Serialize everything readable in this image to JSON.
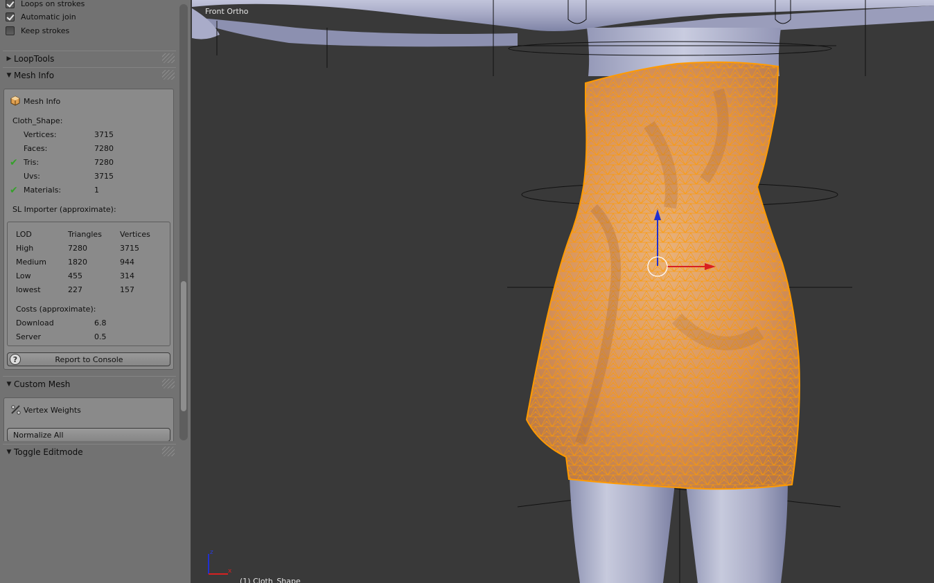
{
  "toolshelf": {
    "options": [
      {
        "label": "Loops on strokes",
        "checked": true
      },
      {
        "label": "Automatic join",
        "checked": true
      },
      {
        "label": "Keep strokes",
        "checked": false
      }
    ],
    "panels": {
      "looptools": "LoopTools",
      "mesh_info": "Mesh Info",
      "custom_mesh": "Custom Mesh",
      "toggle_editmode": "Toggle Editmode"
    },
    "mesh_info": {
      "box_title": "Mesh Info",
      "object_name": "Cloth_Shape:",
      "stats": [
        {
          "label": "Vertices:",
          "value": "3715",
          "ok": false
        },
        {
          "label": "Faces:",
          "value": "7280",
          "ok": false
        },
        {
          "label": "Tris:",
          "value": "7280",
          "ok": true
        },
        {
          "label": "Uvs:",
          "value": "3715",
          "ok": false
        },
        {
          "label": "Materials:",
          "value": "1",
          "ok": true
        }
      ],
      "importer_title": "SL Importer (approximate):",
      "lod_table": {
        "headers": [
          "LOD",
          "Triangles",
          "Vertices"
        ],
        "rows": [
          [
            "High",
            "7280",
            "3715"
          ],
          [
            "Medium",
            "1820",
            "944"
          ],
          [
            "Low",
            "455",
            "314"
          ],
          [
            "lowest",
            "227",
            "157"
          ]
        ]
      },
      "costs_title": "Costs (approximate):",
      "costs": [
        {
          "label": "Download",
          "value": "6.8"
        },
        {
          "label": "Server",
          "value": "0.5"
        }
      ],
      "report_button": "Report to Console"
    },
    "custom_mesh": {
      "vertex_weights": "Vertex Weights",
      "normalize_button": "Normalize All"
    }
  },
  "viewport": {
    "view_label": "Front Ortho",
    "object_label": "(1) Cloth_Shape",
    "axis_z": "z",
    "axis_x": "x"
  },
  "colors": {
    "mesh_wire": "#ff9a00",
    "selection_fill": "#e8a25a",
    "body": "#9ea2bd",
    "gizmo_x": "#d92020",
    "gizmo_z": "#2030d0"
  }
}
